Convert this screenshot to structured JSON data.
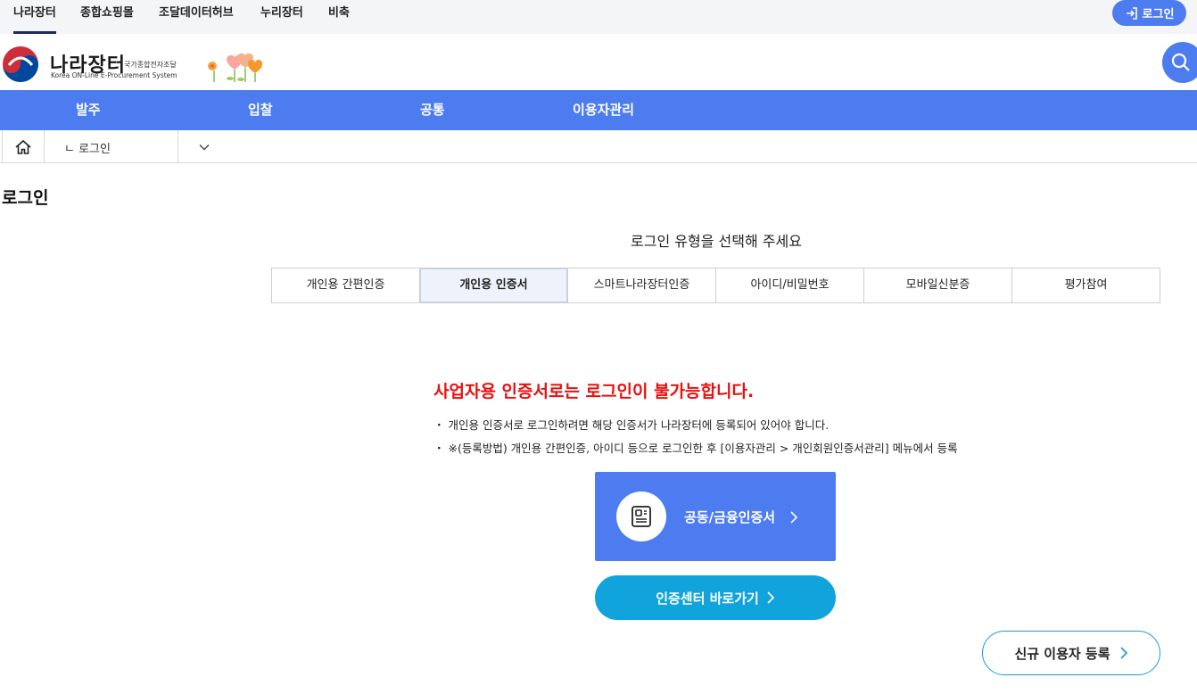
{
  "topbar": {
    "links": [
      "나라장터",
      "종합쇼핑몰",
      "조달데이터허브",
      "누리장터",
      "비축"
    ],
    "active_index": 0,
    "login_label": "로그인"
  },
  "header": {
    "logo_title": "나라장터",
    "logo_sub_kr": "국가종합전자조달",
    "logo_sub_en": "Korea ON-Line E-Procurement System",
    "search_icon": "search-icon"
  },
  "mainnav": {
    "items": [
      "발주",
      "입찰",
      "공통",
      "이용자관리"
    ]
  },
  "breadcrumb": {
    "home_icon": "home-icon",
    "current": "ㄴ 로그인"
  },
  "page": {
    "title": "로그인",
    "prompt": "로그인 유형을 선택해 주세요"
  },
  "login_tabs": {
    "items": [
      "개인용 간편인증",
      "개인용 인증서",
      "스마트나라장터인증",
      "아이디/비밀번호",
      "모바일신분증",
      "평가참여"
    ],
    "active_index": 1
  },
  "content": {
    "warning": "사업자용 인증서로는 로그인이 불가능합니다.",
    "notes": [
      "・ 개인용 인증서로 로그인하려면 해당 인증서가 나라장터에 등록되어 있어야 합니다.",
      "・ ※(등록방법) 개인용 간편인증, 아이디 등으로 로그인한 후 [이용자관리 > 개인회원인증서관리] 메뉴에서 등록"
    ],
    "cert_button": "공동/금융인증서",
    "center_button": "인증센터 바로가기",
    "register_button": "신규 이용자 등록"
  },
  "colors": {
    "primary": "#4c7cf0",
    "cyan": "#10a3dc",
    "warning": "#e8100f"
  }
}
